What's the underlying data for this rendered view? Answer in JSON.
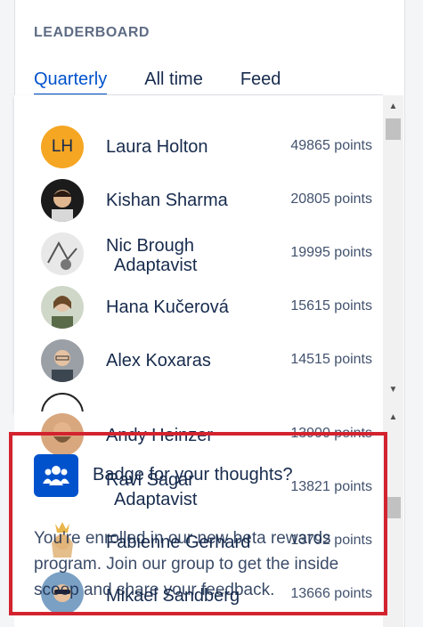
{
  "leaderboard": {
    "title": "LEADERBOARD",
    "tabs": [
      {
        "label": "Quarterly",
        "active": true
      },
      {
        "label": "All time",
        "active": false
      },
      {
        "label": "Feed",
        "active": false
      }
    ],
    "entries": [
      {
        "name": "Laura Holton",
        "name_sub": "",
        "points": "49865 points",
        "avatar": "initials-avatar",
        "initials": "LH"
      },
      {
        "name": "Kishan Sharma",
        "name_sub": "",
        "points": "20805 points",
        "avatar": "memoji-avatar"
      },
      {
        "name": "Nic Brough",
        "name_sub": "Adaptavist",
        "points": "19995 points",
        "avatar": "sketch-avatar"
      },
      {
        "name": "Hana Kučerová",
        "name_sub": "",
        "points": "15615 points",
        "avatar": "photo-avatar"
      },
      {
        "name": "Alex Koxaras",
        "name_sub": "",
        "points": "14515 points",
        "avatar": "photo-avatar"
      }
    ],
    "entries_lower": [
      {
        "name": "Andy Heinzer",
        "name_sub": "",
        "points": "13900 points",
        "avatar": "photo-avatar"
      },
      {
        "name": "Ravi Sagar",
        "name_sub": "Adaptavist",
        "points": "13821 points",
        "avatar": "photo-avatar"
      },
      {
        "name": "Fabienne Gerhard",
        "name_sub": "",
        "points": "13792 points",
        "avatar": "cartoon-avatar"
      },
      {
        "name": "Mikael Sandberg",
        "name_sub": "",
        "points": "13666 points",
        "avatar": "photo-avatar"
      }
    ]
  },
  "popup": {
    "title": "Badge for your thoughts?",
    "body": "You're enrolled in our new beta rewards program. Join our group to get the inside scoop and share your feedback.",
    "icon": "group-icon"
  },
  "colors": {
    "accent": "#0052cc",
    "highlight_border": "#d3232f",
    "initials_bg": "#f5a623"
  }
}
